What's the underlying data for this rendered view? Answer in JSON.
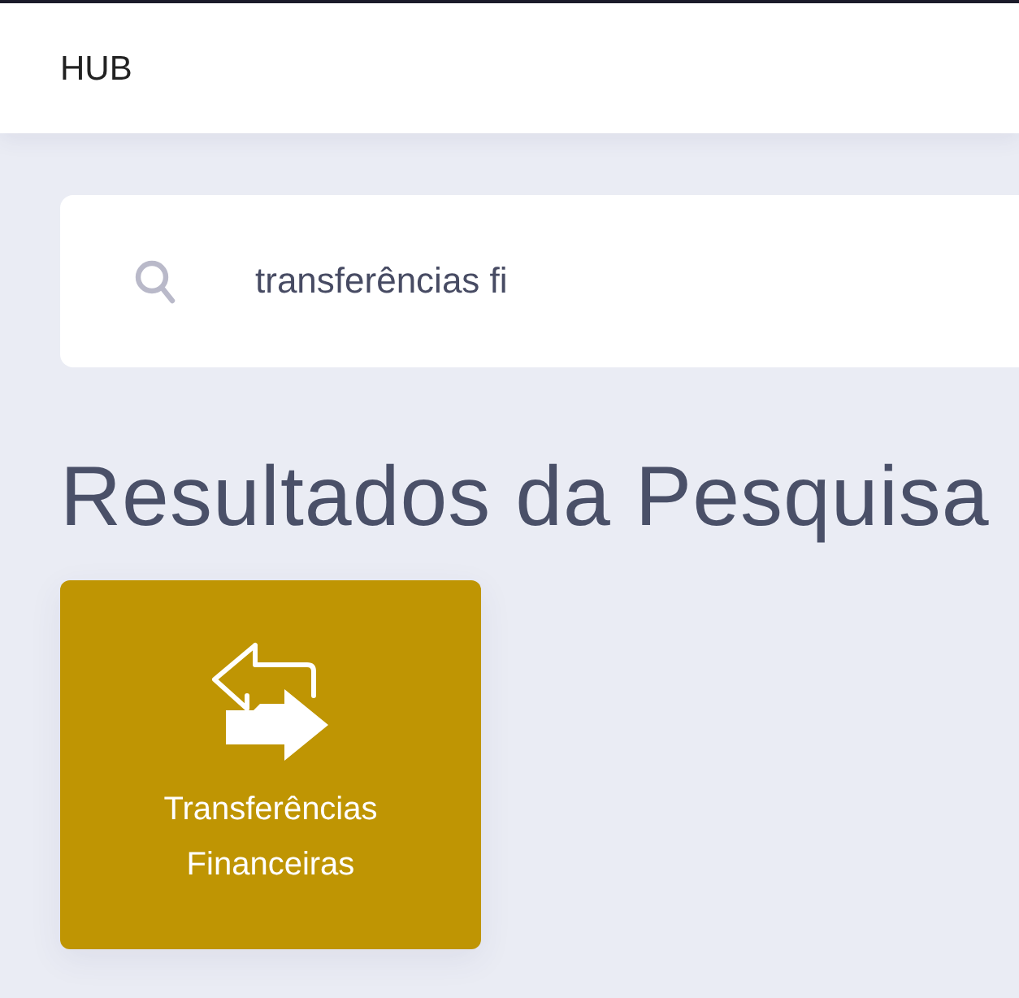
{
  "header": {
    "title": "HUB"
  },
  "search": {
    "value": "transferências fi"
  },
  "results": {
    "heading": "Resultados da Pesquisa",
    "items": [
      {
        "label": "Transferências Financeiras"
      }
    ]
  }
}
